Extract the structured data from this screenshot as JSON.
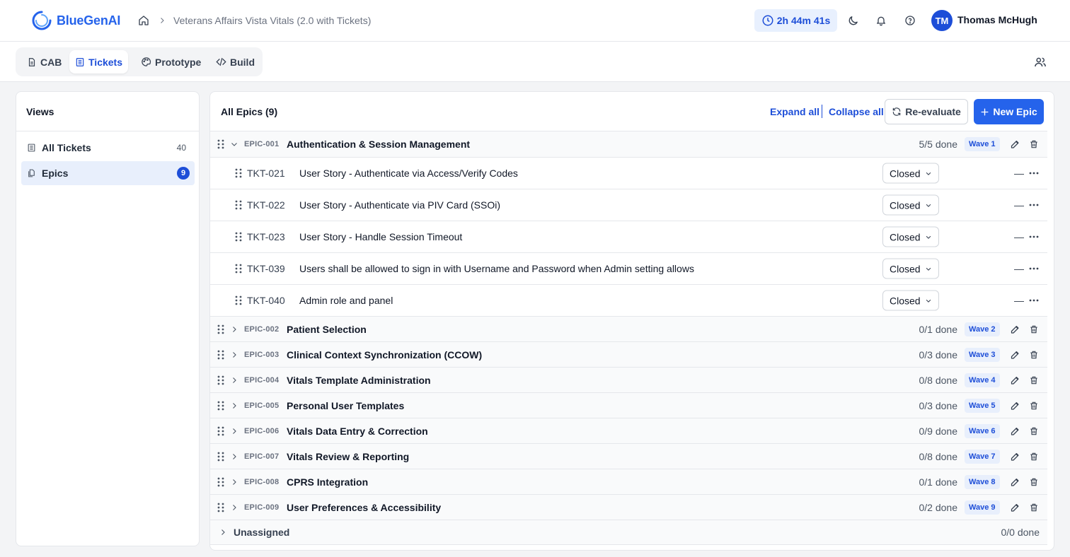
{
  "app": {
    "name": "BlueGenAI"
  },
  "breadcrumb": {
    "project": "Veterans Affairs Vista Vitals (2.0 with Tickets)"
  },
  "header": {
    "timer": "2h 44m 41s",
    "user_initials": "TM",
    "user_name": "Thomas McHugh"
  },
  "tabs": [
    {
      "label": "CAB",
      "icon": "document-icon"
    },
    {
      "label": "Tickets",
      "icon": "list-icon",
      "active": true
    },
    {
      "label": "Prototype",
      "icon": "palette-icon"
    },
    {
      "label": "Build",
      "icon": "code-icon"
    }
  ],
  "sidebar": {
    "title": "Views",
    "items": [
      {
        "label": "All Tickets",
        "count": "40"
      },
      {
        "label": "Epics",
        "count": "9",
        "active": true
      }
    ]
  },
  "main": {
    "title": "All Epics (9)",
    "expand_all": "Expand all",
    "collapse_all": "Collapse all",
    "reevaluate": "Re-evaluate",
    "new_epic": "New Epic"
  },
  "epics": [
    {
      "id": "EPIC-001",
      "title": "Authentication & Session Management",
      "done": "5/5 done",
      "wave": "Wave 1",
      "expanded": true,
      "tickets": [
        {
          "id": "TKT-021",
          "title": "User Story - Authenticate via Access/Verify Codes",
          "status": "Closed",
          "assignee": "—"
        },
        {
          "id": "TKT-022",
          "title": "User Story - Authenticate via PIV Card (SSOi)",
          "status": "Closed",
          "assignee": "—"
        },
        {
          "id": "TKT-023",
          "title": "User Story - Handle Session Timeout",
          "status": "Closed",
          "assignee": "—"
        },
        {
          "id": "TKT-039",
          "title": "Users shall be allowed to sign in with Username and Password when Admin setting allows",
          "status": "Closed",
          "assignee": "—"
        },
        {
          "id": "TKT-040",
          "title": "Admin role and panel",
          "status": "Closed",
          "assignee": "—"
        }
      ]
    },
    {
      "id": "EPIC-002",
      "title": "Patient Selection",
      "done": "0/1 done",
      "wave": "Wave 2"
    },
    {
      "id": "EPIC-003",
      "title": "Clinical Context Synchronization (CCOW)",
      "done": "0/3 done",
      "wave": "Wave 3"
    },
    {
      "id": "EPIC-004",
      "title": "Vitals Template Administration",
      "done": "0/8 done",
      "wave": "Wave 4"
    },
    {
      "id": "EPIC-005",
      "title": "Personal User Templates",
      "done": "0/3 done",
      "wave": "Wave 5"
    },
    {
      "id": "EPIC-006",
      "title": "Vitals Data Entry & Correction",
      "done": "0/9 done",
      "wave": "Wave 6"
    },
    {
      "id": "EPIC-007",
      "title": "Vitals Review & Reporting",
      "done": "0/8 done",
      "wave": "Wave 7"
    },
    {
      "id": "EPIC-008",
      "title": "CPRS Integration",
      "done": "0/1 done",
      "wave": "Wave 8"
    },
    {
      "id": "EPIC-009",
      "title": "User Preferences & Accessibility",
      "done": "0/2 done",
      "wave": "Wave 9"
    }
  ],
  "unassigned": {
    "title": "Unassigned",
    "done": "0/0 done"
  },
  "colors": {
    "primary": "#2563eb",
    "primary_dark": "#1d4ed8",
    "badge_bg": "#e8effc"
  }
}
